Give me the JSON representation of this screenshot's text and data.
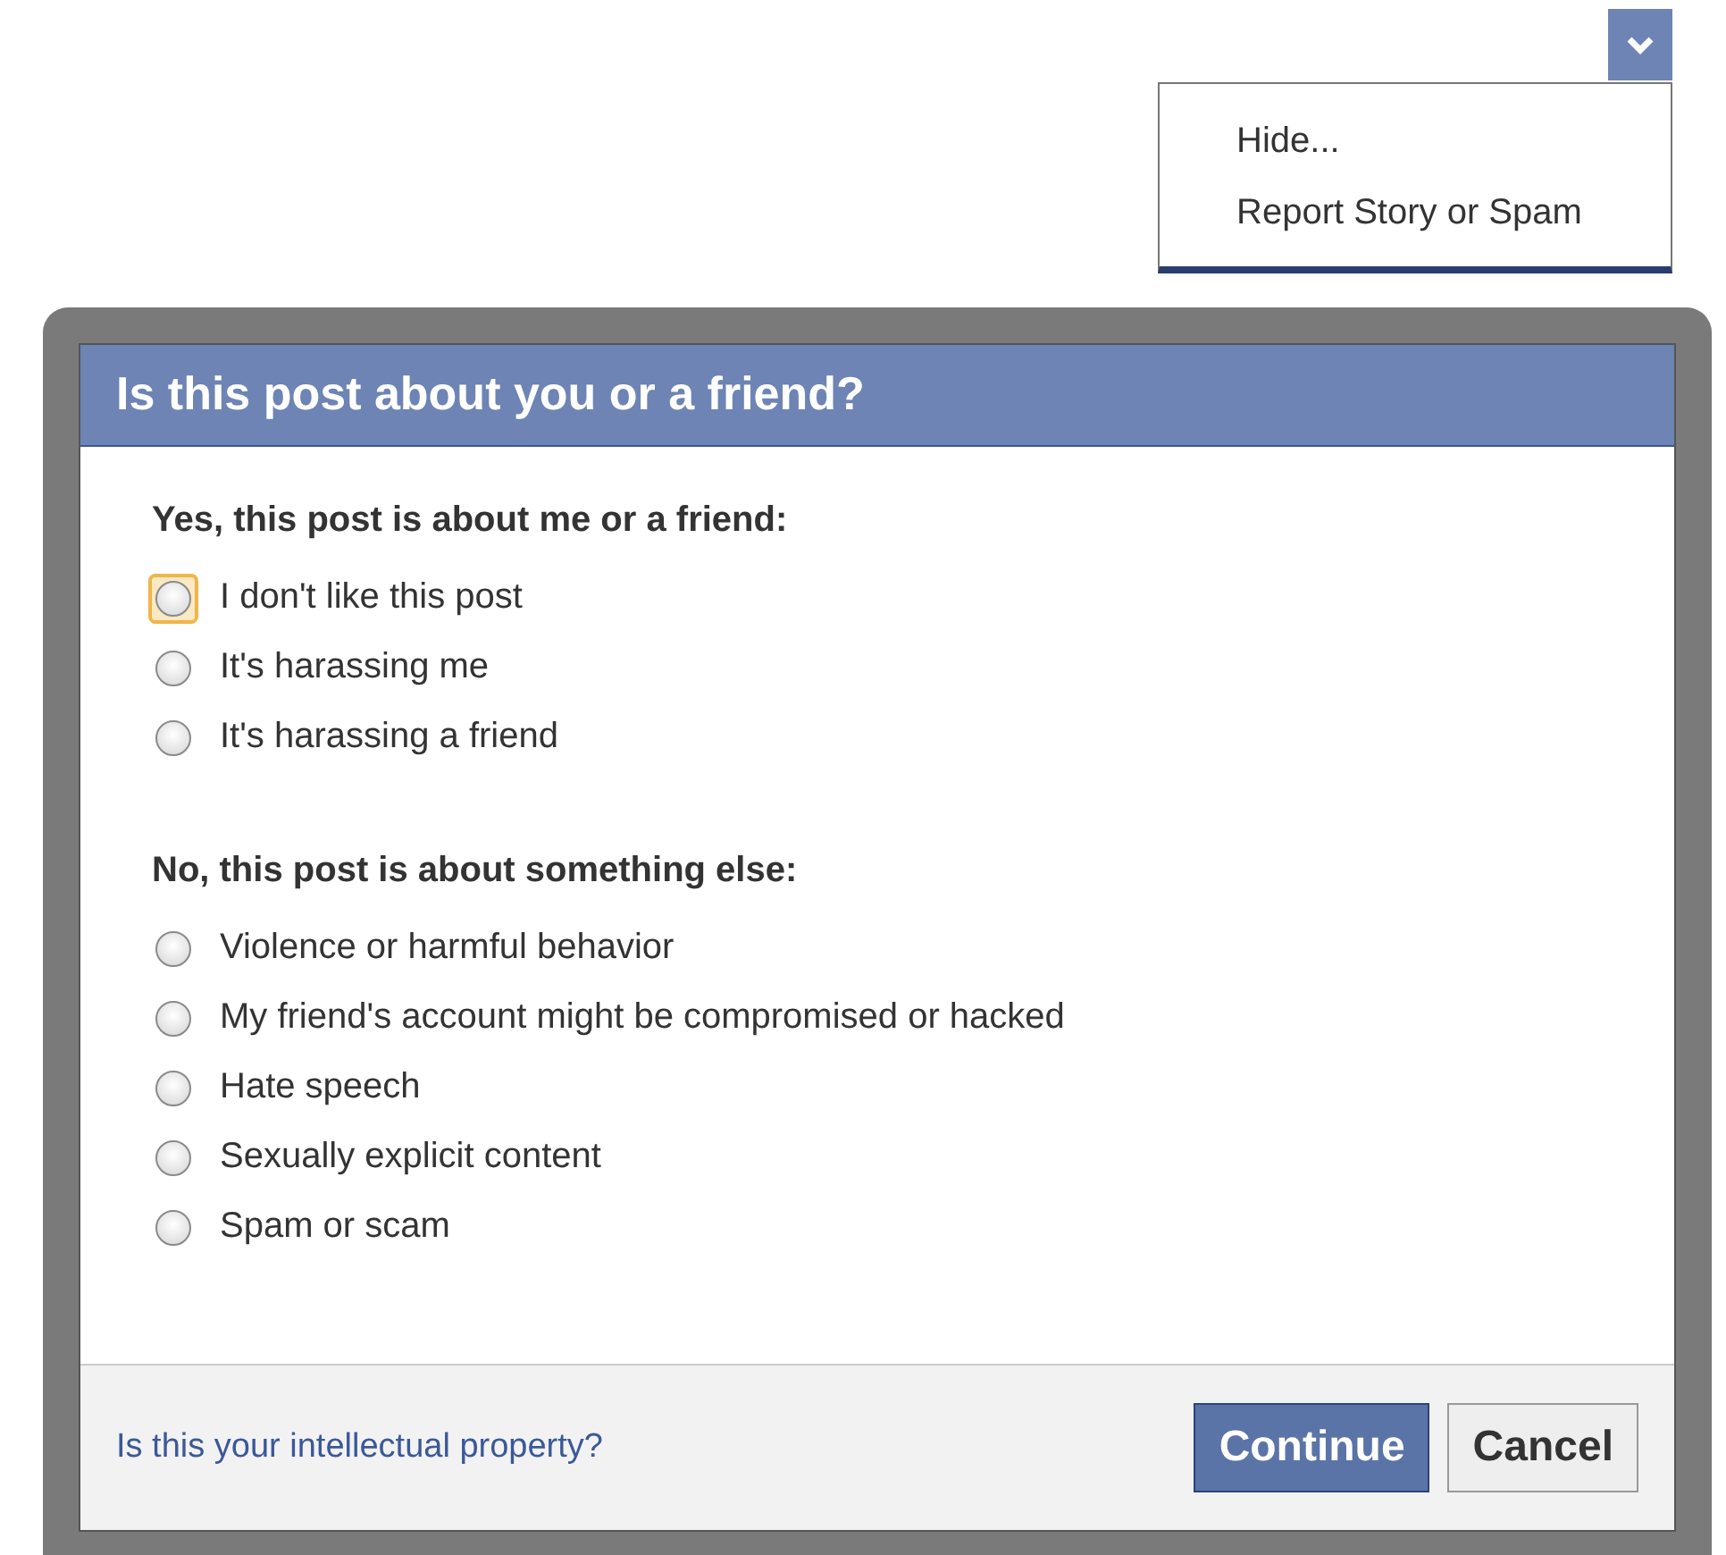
{
  "story_menu": {
    "items": [
      {
        "label": "Hide..."
      },
      {
        "label": "Report Story or Spam"
      }
    ]
  },
  "dialog": {
    "title": "Is this post about you or a friend?",
    "groups": [
      {
        "heading": "Yes, this post is about me or a friend:",
        "options": [
          {
            "label": "I don't like this post",
            "selected": false,
            "focused": true
          },
          {
            "label": "It's harassing me",
            "selected": false,
            "focused": false
          },
          {
            "label": "It's harassing a friend",
            "selected": false,
            "focused": false
          }
        ]
      },
      {
        "heading": "No, this post is about something else:",
        "options": [
          {
            "label": "Violence or harmful behavior",
            "selected": false,
            "focused": false
          },
          {
            "label": "My friend's account might be compromised or hacked",
            "selected": false,
            "focused": false
          },
          {
            "label": "Hate speech",
            "selected": false,
            "focused": false
          },
          {
            "label": "Sexually explicit content",
            "selected": false,
            "focused": false
          },
          {
            "label": "Spam or scam",
            "selected": false,
            "focused": false
          }
        ]
      }
    ],
    "footer_link": "Is this your intellectual property?",
    "buttons": [
      {
        "label": "Continue",
        "kind": "primary"
      },
      {
        "label": "Cancel",
        "kind": "secondary"
      }
    ]
  }
}
